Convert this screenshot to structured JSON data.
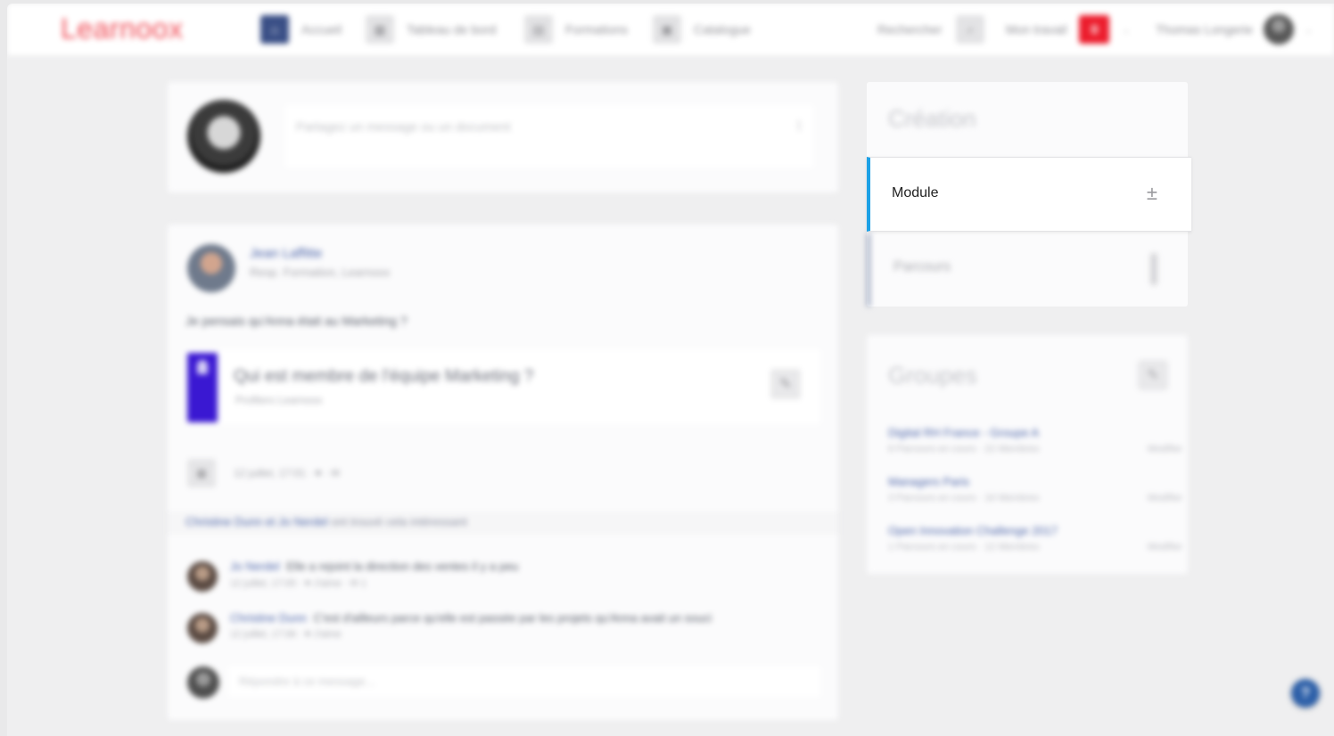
{
  "header": {
    "logo": "Learnoox",
    "nav": [
      {
        "label": "Accueil",
        "icon": "home-icon"
      },
      {
        "label": "Tableau de bord",
        "icon": "dashboard-icon"
      },
      {
        "label": "Formations",
        "icon": "formations-icon"
      },
      {
        "label": "Catalogue",
        "icon": "catalogue-icon"
      }
    ],
    "search_label": "Rechercher",
    "mon_travail_label": "Mon travail",
    "notification_count": "0",
    "user_name": "Thomas Longerie"
  },
  "composer": {
    "placeholder": "Partagez un message ou un document"
  },
  "post": {
    "author": "Jean Laffitte",
    "subtitle": "Resp. Formation, Learnoox",
    "text": "Je pensais qu'Anna était au Marketing ?",
    "quiz_title": "Qui est membre de l'équipe Marketing ?",
    "quiz_subtitle": "Profilers Learnoox",
    "meta": "12 juillet, 17:01 · ♥ · ✉",
    "likes_names": "Christine Dunn et Jo Nerdel",
    "likes_text": "ont trouvé cela intéressant",
    "comments": [
      {
        "who": "Jo Nerdel",
        "text": "Elle a rejoint la direction des ventes il y a peu",
        "meta": "12 juillet, 17:05 · ♥ J'aime · ✉ 1"
      },
      {
        "who": "Christine Dunn",
        "text": "C'est d'ailleurs parce qu'elle est passée par les projets qu'Anna avait un souci",
        "meta": "12 juillet, 17:06 · ♥ J'aime"
      }
    ],
    "reply_placeholder": "Répondre à ce message..."
  },
  "creation": {
    "title": "Création",
    "module_label": "Module",
    "parcours_label": "Parcours"
  },
  "groups": {
    "title": "Groupes",
    "items": [
      {
        "name": "Digital RH France - Groupe A",
        "meta": "8 Parcours en cours · 22 Membres",
        "action": "Modifier"
      },
      {
        "name": "Managers Paris",
        "meta": "3 Parcours en cours · 16 Membres",
        "action": "Modifier"
      },
      {
        "name": "Open Innovation Challenge 2017",
        "meta": "1 Parcours en cours · 12 Membres",
        "action": "Modifier"
      }
    ]
  },
  "help_label": "?"
}
